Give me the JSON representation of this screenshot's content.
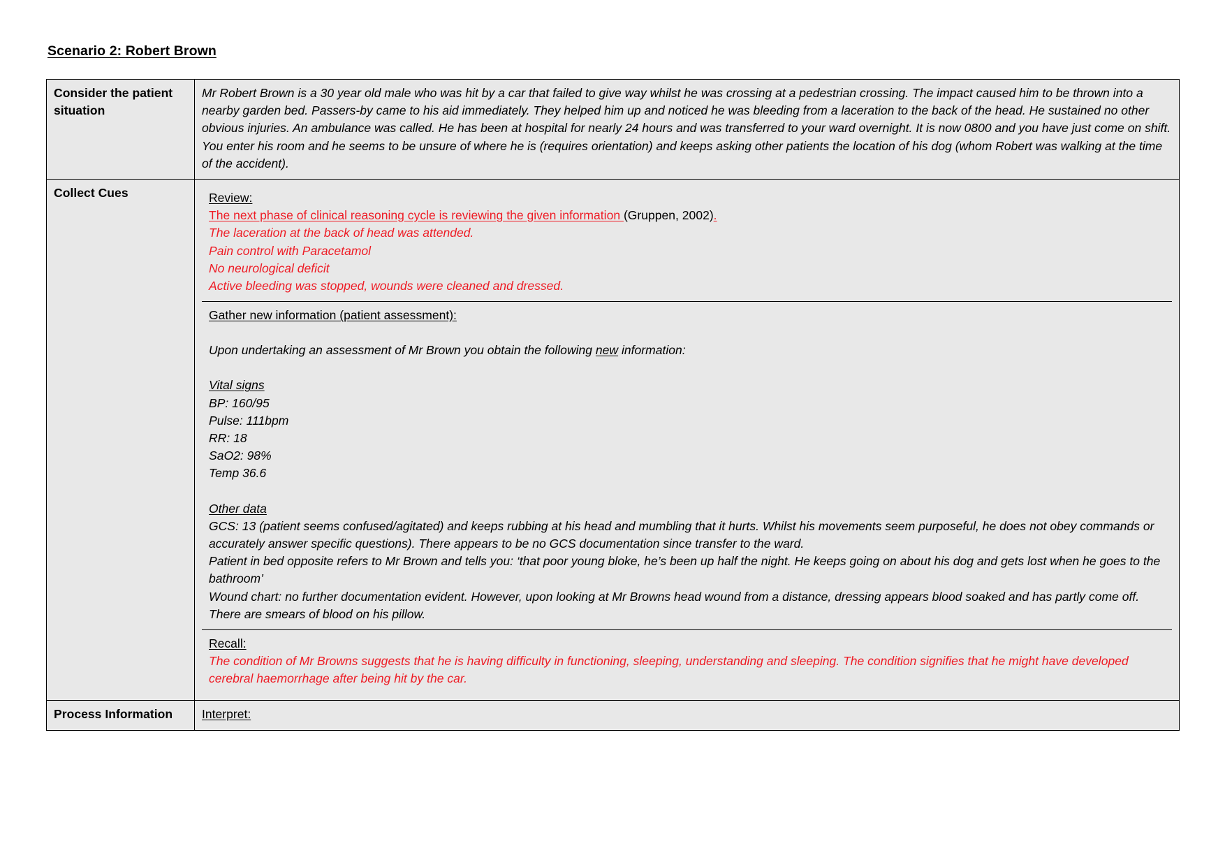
{
  "document": {
    "title": "Scenario 2: Robert Brown"
  },
  "table": {
    "rows": [
      {
        "label": "Consider the patient situation",
        "paragraph": "Mr Robert Brown is a 30 year old male who was hit by a car that failed to give way whilst he was crossing at a pedestrian crossing.  The impact caused him to be thrown into a nearby garden bed.  Passers-by came to his aid immediately. They helped him up and noticed he was bleeding from a laceration to the back of the head. He sustained no other obvious injuries.  An ambulance was called.  He has been at hospital for nearly 24 hours and was transferred to your ward overnight.  It is now 0800 and you have just come on shift.  You enter his room and he seems to be unsure of where he is (requires orientation) and keeps asking other patients the location of his dog (whom Robert was walking at the time of the accident)."
      },
      {
        "label": "Collect Cues"
      },
      {
        "label": "Process Information"
      }
    ]
  },
  "collect_cues": {
    "review": {
      "heading": "Review:",
      "citation_line": {
        "red_underlined": "The next phase of clinical reasoning cycle is reviewing the given information ",
        "black_citation": "(Gruppen, 2002)",
        "red_period": "."
      },
      "red_lines": [
        "The laceration at the back of head was attended.",
        "Pain control with Paracetamol",
        "No neurological deficit",
        "Active bleeding was stopped, wounds were cleaned and dressed."
      ]
    },
    "gather": {
      "heading": "Gather new information (patient assessment):",
      "intro_before": "Upon undertaking an assessment of Mr Brown you obtain the following ",
      "intro_emphasis": "new",
      "intro_after": " information:",
      "vital_signs_heading": "Vital signs",
      "vital_signs": [
        "BP: 160/95",
        "Pulse: 111bpm",
        "RR: 18",
        "SaO2: 98%",
        "Temp 36.6"
      ],
      "other_data_heading": "Other data",
      "other_data_paragraphs": [
        "GCS: 13 (patient seems confused/agitated) and keeps rubbing at his head and mumbling that it hurts.  Whilst his movements seem purposeful, he does not obey commands or accurately answer specific questions).  There appears to be no GCS documentation since transfer to the ward.",
        "Patient in bed opposite refers to Mr Brown and tells you: ‘that poor young bloke, he’s been up half the night.  He keeps going on about his dog and gets lost when he goes to the bathroom’",
        "Wound chart: no further documentation evident.  However, upon looking at Mr Browns head wound from a distance, dressing appears blood soaked and has partly come off.  There are smears of blood on his pillow."
      ]
    },
    "recall": {
      "heading": "Recall:",
      "red_paragraph": "The condition of Mr Browns suggests that he is having difficulty in functioning, sleeping, understanding and sleeping. The condition signifies that he might have developed cerebral haemorrhage after being hit by the car."
    }
  },
  "process_information": {
    "heading": "Interpret:"
  },
  "colors": {
    "annotation_red": "#ee1c25",
    "cell_background": "#e8e8e8",
    "border": "#000000"
  }
}
